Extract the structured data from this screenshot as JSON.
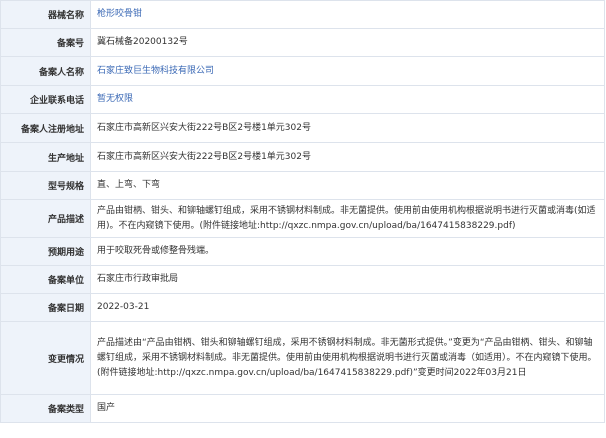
{
  "rows": [
    {
      "key": "器械名称",
      "value": "枪形咬骨钳",
      "style": "link"
    },
    {
      "key": "备案号",
      "value": "冀石械备20200132号",
      "style": "plain"
    },
    {
      "key": "备案人名称",
      "value": "石家庄致巨生物科技有限公司",
      "style": "link"
    },
    {
      "key": "企业联系电话",
      "value": "暂无权限",
      "style": "blue"
    },
    {
      "key": "备案人注册地址",
      "value": "石家庄市高新区兴安大街222号B区2号楼1单元302号",
      "style": "plain"
    },
    {
      "key": "生产地址",
      "value": "石家庄市高新区兴安大街222号B区2号楼1单元302号",
      "style": "plain"
    },
    {
      "key": "型号规格",
      "value": "直、上弯、下弯",
      "style": "plain"
    },
    {
      "key": "产品描述",
      "value": "产品由钳柄、钳头、和铆轴螺钉组成，采用不锈钢材料制成。非无菌提供。使用前由使用机构根据说明书进行灭菌或消毒(如适用)。不在内窥镜下使用。(附件链接地址:http://qxzc.nmpa.gov.cn/upload/ba/1647415838229.pdf)",
      "style": "plain"
    },
    {
      "key": "预期用途",
      "value": "用于咬取死骨或修整骨残端。",
      "style": "plain"
    },
    {
      "key": "备案单位",
      "value": "石家庄市行政审批局",
      "style": "plain"
    },
    {
      "key": "备案日期",
      "value": "2022-03-21",
      "style": "plain"
    },
    {
      "key": "变更情况",
      "value": "产品描述由“产品由钳柄、钳头和铆轴螺钉组成，采用不锈钢材料制成。非无菌形式提供。”变更为“产品由钳柄、钳头、和铆轴螺钉组成，采用不锈钢材料制成。非无菌提供。使用前由使用机构根据说明书进行灭菌或消毒（如适用）。不在内窥镜下使用。(附件链接地址:http://qxzc.nmpa.gov.cn/upload/ba/1647415838229.pdf)”变更时间2022年03月21日",
      "style": "plain"
    },
    {
      "key": "备案类型",
      "value": "国产",
      "style": "plain"
    }
  ]
}
